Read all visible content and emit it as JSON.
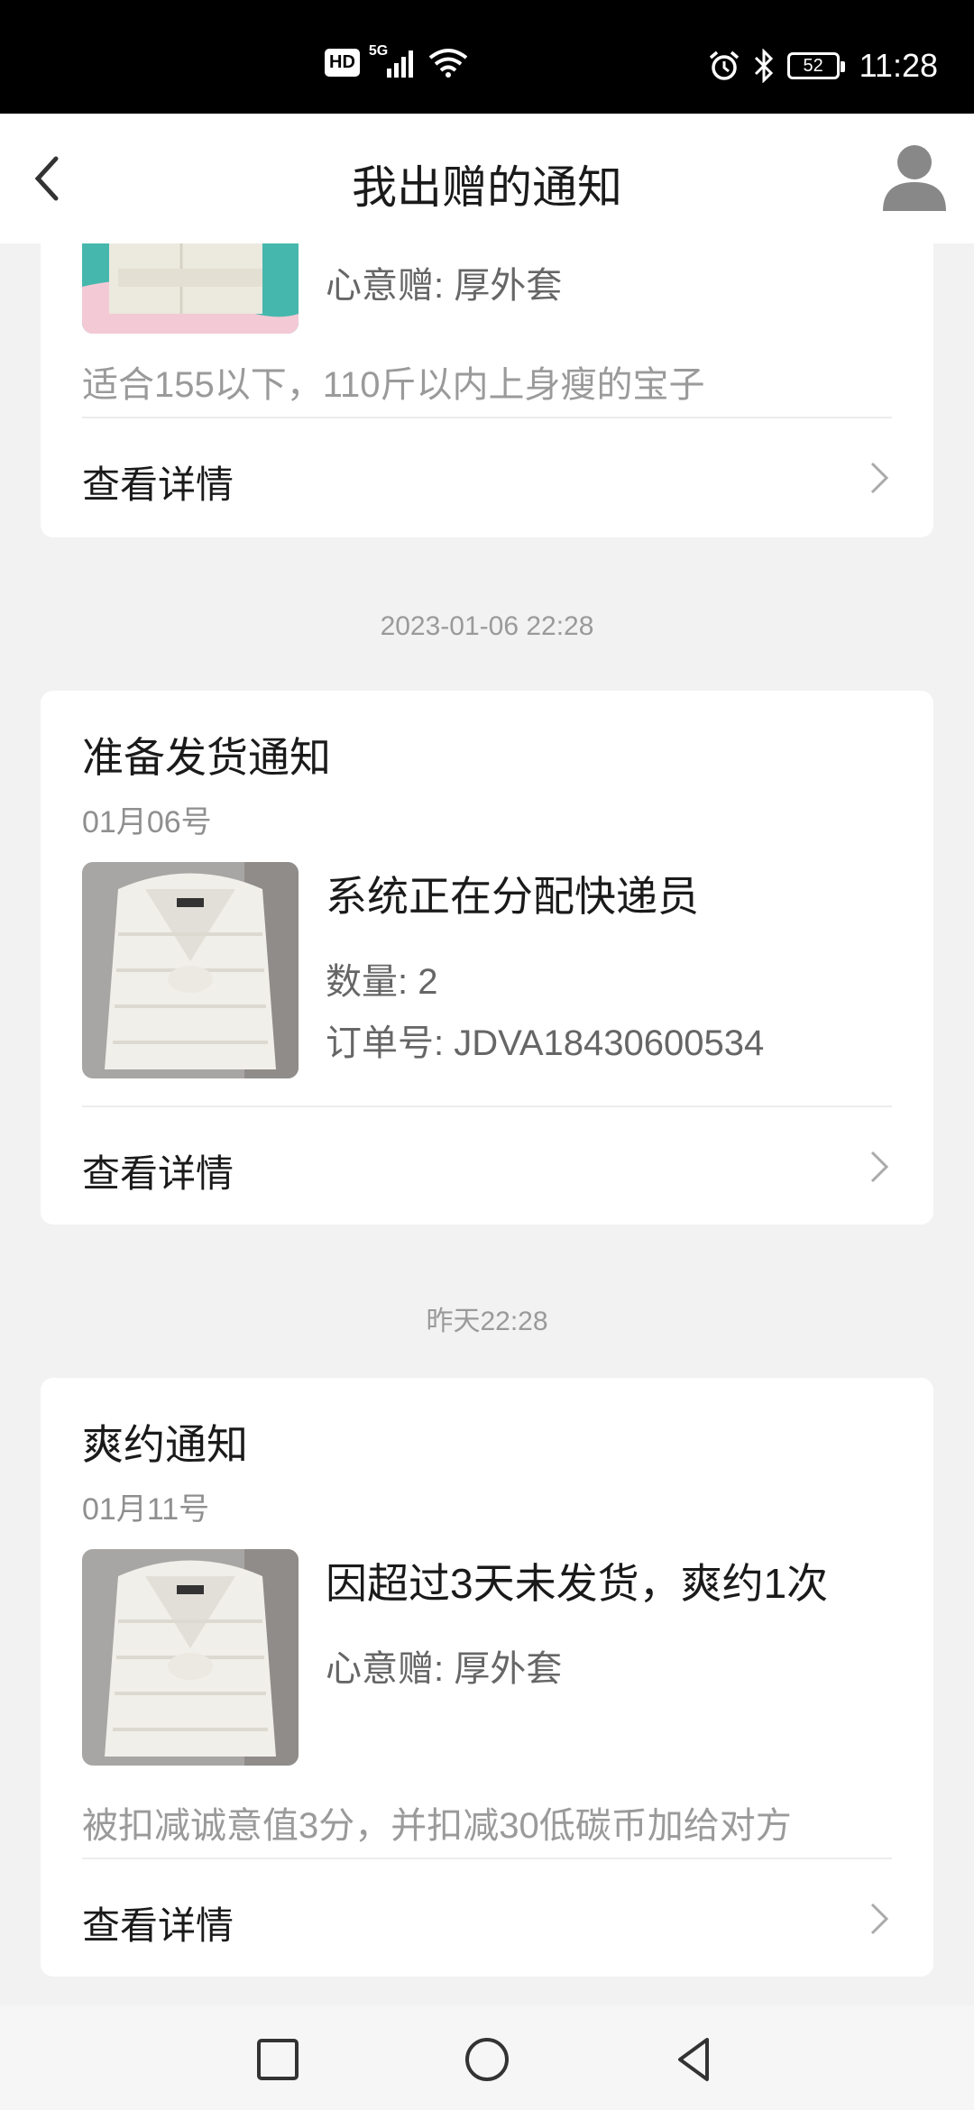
{
  "status_bar": {
    "time": "11:28",
    "battery": "52",
    "network": "5G",
    "hd": "HD",
    "icons": [
      "hd-icon",
      "signal-icon",
      "wifi-icon",
      "alarm-icon",
      "bluetooth-icon",
      "battery-icon"
    ]
  },
  "header": {
    "title": "我出赠的通知",
    "back_icon": "chevron-left-icon",
    "profile_icon": "user-icon"
  },
  "cards": [
    {
      "main": "心意赠: 厚外套",
      "description": "适合155以下，110斤以内上身瘦的宝子",
      "detail_label": "查看详情"
    },
    {
      "timestamp": "2023-01-06 22:28",
      "title": "准备发货通知",
      "date": "01月06号",
      "main": "系统正在分配快递员",
      "quantity": "数量: 2",
      "order": "订单号: JDVA18430600534",
      "detail_label": "查看详情"
    },
    {
      "timestamp": "昨天22:28",
      "title": "爽约通知",
      "date": "01月11号",
      "main": "因超过3天未发货，爽约1次",
      "sub": "心意赠: 厚外套",
      "description": "被扣减诚意值3分，并扣减30低碳币加给对方",
      "detail_label": "查看详情"
    }
  ],
  "colors": {
    "background": "#f2f2f2",
    "card": "#ffffff",
    "muted_text": "#9a9a9a",
    "primary_text": "#1a1a1a"
  },
  "nav": {
    "icons": [
      "recent-apps-icon",
      "home-icon",
      "back-icon"
    ]
  }
}
